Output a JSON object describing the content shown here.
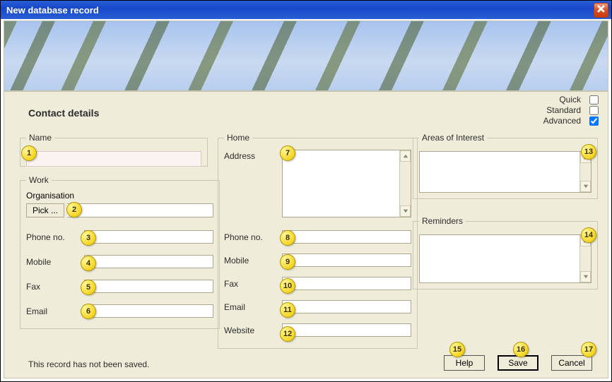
{
  "window": {
    "title": "New database record"
  },
  "heading": "Contact details",
  "views": {
    "quick": {
      "label": "Quick",
      "checked": false
    },
    "standard": {
      "label": "Standard",
      "checked": false
    },
    "advanced": {
      "label": "Advanced",
      "checked": true
    }
  },
  "name_fs": {
    "legend": "Name",
    "value": ""
  },
  "work": {
    "legend": "Work",
    "org_label": "Organisation",
    "pick_label": "Pick ...",
    "org_value": "",
    "fields": [
      {
        "label": "Phone no.",
        "value": ""
      },
      {
        "label": "Mobile",
        "value": ""
      },
      {
        "label": "Fax",
        "value": ""
      },
      {
        "label": "Email",
        "value": ""
      }
    ]
  },
  "home": {
    "legend": "Home",
    "address_label": "Address",
    "address_value": "",
    "fields": [
      {
        "label": "Phone no.",
        "value": ""
      },
      {
        "label": "Mobile",
        "value": ""
      },
      {
        "label": "Fax",
        "value": ""
      },
      {
        "label": "Email",
        "value": ""
      },
      {
        "label": "Website",
        "value": ""
      }
    ]
  },
  "areas": {
    "legend": "Areas of Interest"
  },
  "reminders": {
    "legend": "Reminders"
  },
  "status": "This record has not been saved.",
  "buttons": {
    "help": "Help",
    "save": "Save",
    "cancel": "Cancel"
  },
  "markers": [
    "1",
    "2",
    "3",
    "4",
    "5",
    "6",
    "7",
    "8",
    "9",
    "10",
    "11",
    "12",
    "13",
    "14",
    "15",
    "16",
    "17"
  ]
}
